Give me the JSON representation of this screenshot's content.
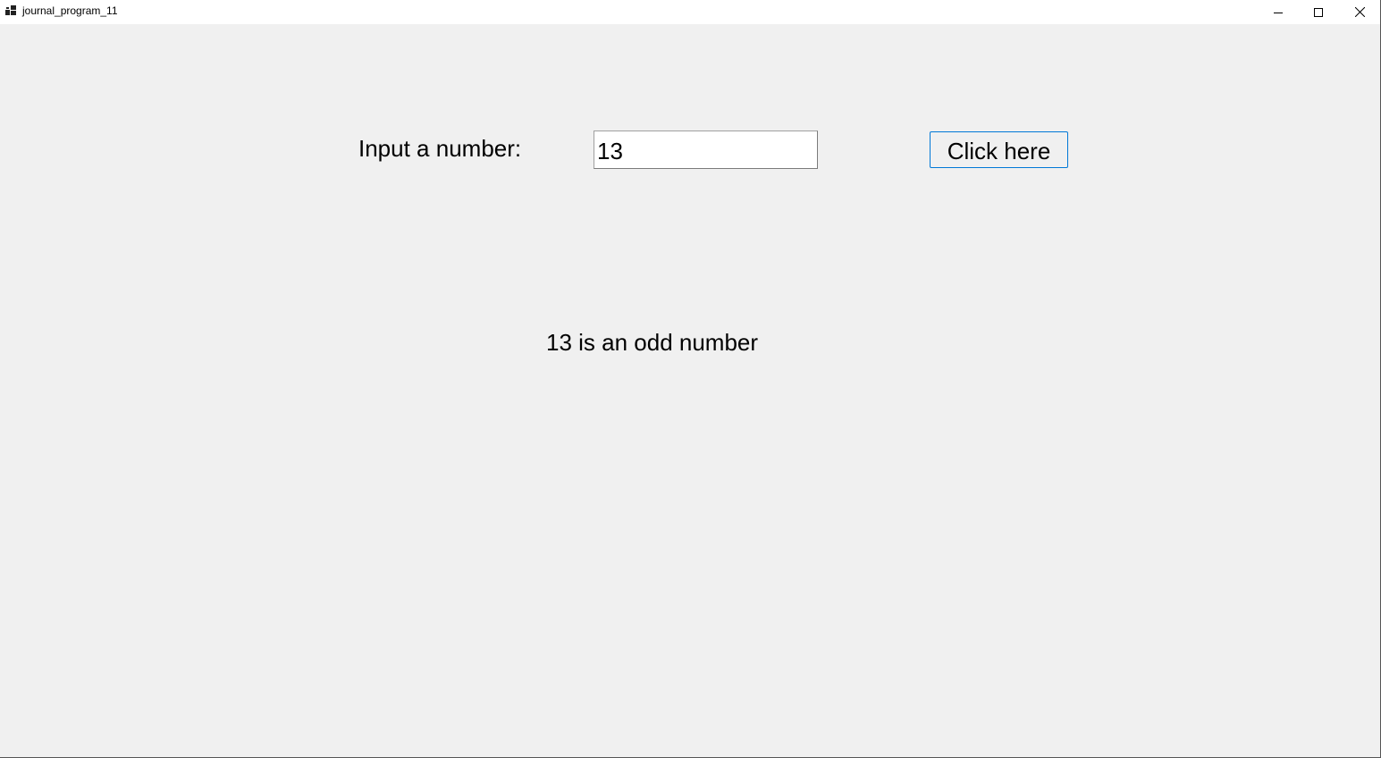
{
  "window": {
    "title": "journal_program_11",
    "icon": "app-window-icon",
    "controls": {
      "minimize_icon": "minimize-icon",
      "maximize_icon": "maximize-icon",
      "close_icon": "close-icon"
    }
  },
  "form": {
    "label": "Input a number:",
    "input_value": "13",
    "button_label": "Click here"
  },
  "result": {
    "text": "13 is an odd number"
  },
  "colors": {
    "background": "#f0f0f0",
    "titlebar": "#ffffff",
    "button_border": "#0078d7"
  }
}
